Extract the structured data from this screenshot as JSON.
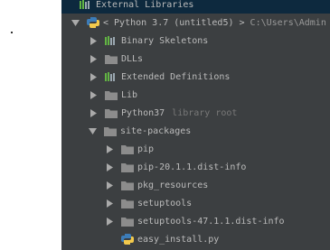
{
  "project_tree": {
    "external_libraries_label": "External Libraries",
    "sdk": {
      "label": "< Python 3.7 (untitled5) >",
      "path": "C:\\Users\\Admin"
    },
    "items": [
      {
        "label": "Binary Skeletons",
        "type": "lib"
      },
      {
        "label": "DLLs",
        "type": "folder"
      },
      {
        "label": "Extended Definitions",
        "type": "lib"
      },
      {
        "label": "Lib",
        "type": "folder"
      },
      {
        "label": "Python37",
        "hint": "library root",
        "type": "folder"
      },
      {
        "label": "site-packages",
        "type": "folder"
      }
    ],
    "site_packages": [
      {
        "label": "pip",
        "type": "folder"
      },
      {
        "label": "pip-20.1.1.dist-info",
        "type": "folder"
      },
      {
        "label": "pkg_resources",
        "type": "folder"
      },
      {
        "label": "setuptools",
        "type": "folder"
      },
      {
        "label": "setuptools-47.1.1.dist-info",
        "type": "folder"
      },
      {
        "label": "easy_install.py",
        "type": "python-file"
      }
    ]
  },
  "colors": {
    "panel_bg": "#3c3f41",
    "selection_bg": "#0d293e",
    "text": "#bbbbbb",
    "hint": "#787878",
    "folder": "#8c8c8c",
    "lib_bars": "#62b543"
  }
}
